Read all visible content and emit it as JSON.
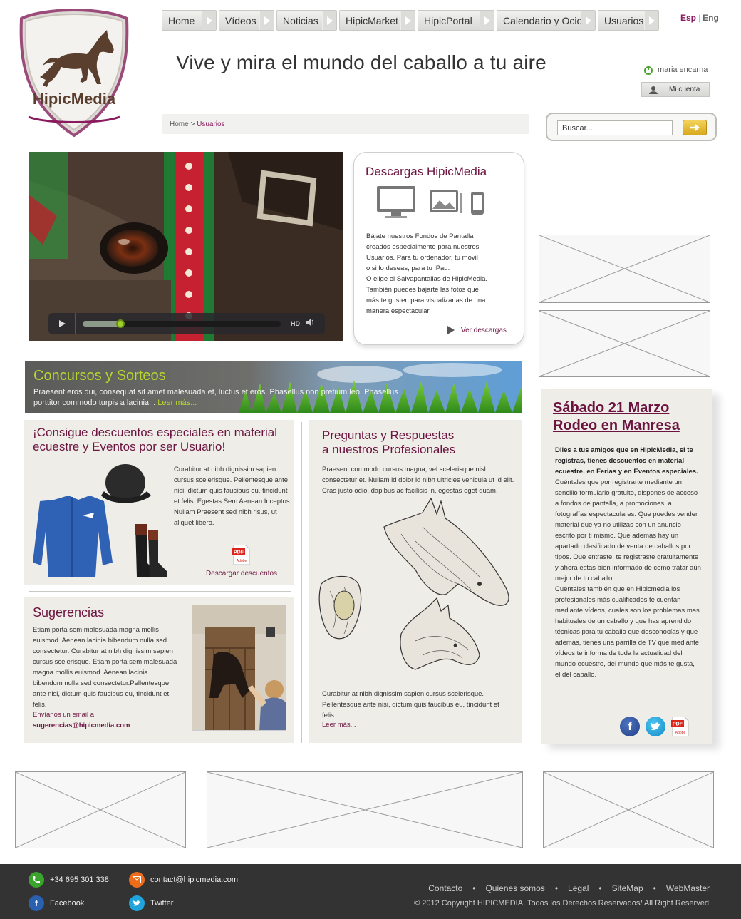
{
  "brand": {
    "name": "HipicMedia",
    "tagline": "Vive y mira el mundo del caballo a tu aire"
  },
  "nav": {
    "items": [
      "Home",
      "Vídeos",
      "Noticias",
      "HipicMarket",
      "HipicPortal",
      "Calendario y Ocio",
      "Usuarios"
    ]
  },
  "lang": {
    "esp": "Esp",
    "eng": "Eng"
  },
  "user": {
    "name": "maria encarna",
    "account_label": "Mi cuenta"
  },
  "breadcrumb": {
    "home": "Home",
    "separator": ">",
    "current": "Usuarios"
  },
  "search": {
    "placeholder": "Buscar..."
  },
  "video": {
    "hd_label": "HD",
    "progress": 0.19
  },
  "downloads": {
    "title": "Descargas HipicMedia",
    "text_lines": [
      "Bájate nuestros Fondos de Pantalla",
      "creados especialmente para nuestros",
      "Usuarios. Para tu ordenador, tu movil",
      "o si lo deseas, para tu iPad.",
      "O elige el Salvapantallas de HipicMedia.",
      "También puedes bajarte las fotos que",
      "más te gusten para visualizarlas de una",
      "manera espectacular."
    ],
    "link": "Ver descargas"
  },
  "contests": {
    "title": "Concursos y Sorteos",
    "text": "Praesent eros dui, consequat sit amet malesuada et, luctus et eros. Phasellus non pretium leo. Phasellus porttitor commodo turpis a lacinia. .",
    "more": "Leer más..."
  },
  "discounts": {
    "title": "¡Consigue descuentos especiales en material ecuestre y Eventos por ser Usuario!",
    "text": "Curabitur at nibh dignissim sapien cursus scelerisque. Pellentesque ante nisi, dictum quis faucibus eu, tincidunt et felis. Egestas Sem Aenean Inceptos Nullam Praesent sed nibh risus, ut aliquet libero.",
    "link": "Descargar descuentos",
    "pdf_label": "Adobe"
  },
  "suggestions": {
    "title": "Sugerencias",
    "text": "Etiam porta sem malesuada magna mollis euismod. Aenean lacinia bibendum nulla sed consectetur. Curabitur at nibh dignissim sapien cursus scelerisque. Etiam porta sem malesuada magna mollis euismod. Aenean lacinia bibendum nulla sed consectetur.Pellentesque ante nisi, dictum quis faucibus eu, tincidunt et felis.",
    "email_intro": "Envíanos un email a",
    "email": "sugerencias@hipicmedia.com"
  },
  "faq": {
    "title_line1": "Preguntas y Respuestas",
    "title_line2": "a nuestros Profesionales",
    "text": "Praesent commodo cursus magna, vel scelerisque nisl consectetur et. Nullam id dolor id nibh ultricies vehicula ut id elit. Cras justo odio, dapibus ac facilisis in, egestas eget quam.",
    "text2": "Curabitur at nibh dignissim sapien cursus scelerisque. Pellentesque ante nisi, dictum quis faucibus eu, tincidunt et felis.",
    "more": "Leer más..."
  },
  "event": {
    "title_line1": "Sábado 21 Marzo",
    "title_line2": "Rodeo en Manresa",
    "bold_text": "Diles a tus amigos que en HipicMedia, si te registras, tienes descuentos en material ecuestre, en Ferias y en Eventos especiales.",
    "text": " Cuéntales que por registrarte mediante un sencillo formulario gratuito, dispones de acceso a fondos de pantalla, a promociones, a fotografías espectaculares. Que puedes vender material que ya no utilizas con un anuncio escrito por ti mismo. Que además hay un apartado clasificado de venta de caballos por tipos. Que entraste, te registraste gratuitamente y ahora estas bien informado de como tratar aún mejor de tu caballo.",
    "text2": "Cuéntales también que en Hipicmedia los profesionales más cualificados te cuentan mediante vídeos, cuales son los problemas mas habituales de un caballo y que has aprendido técnicas para tu caballo que desconocías y que además, tienes una parrilla de TV que mediante vídeos te informa de toda la actualidad del mundo ecuestre, del mundo que más te gusta, el del caballo.",
    "pdf_label": "Adobe"
  },
  "footer": {
    "phone": "+34 695 301 338",
    "email": "contact@hipicmedia.com",
    "facebook": "Facebook",
    "twitter": "Twitter",
    "links": [
      "Contacto",
      "Quienes somos",
      "Legal",
      "SiteMap",
      "WebMaster"
    ],
    "copyright": "© 2012 Copyright HIPICMEDIA. Todos los Derechos Reservados/ All Right Reserved."
  },
  "colors": {
    "brand_purple": "#6b1440",
    "accent_green": "#b7d82c",
    "footer_bg": "#333333",
    "panel_bg": "#efede8"
  }
}
